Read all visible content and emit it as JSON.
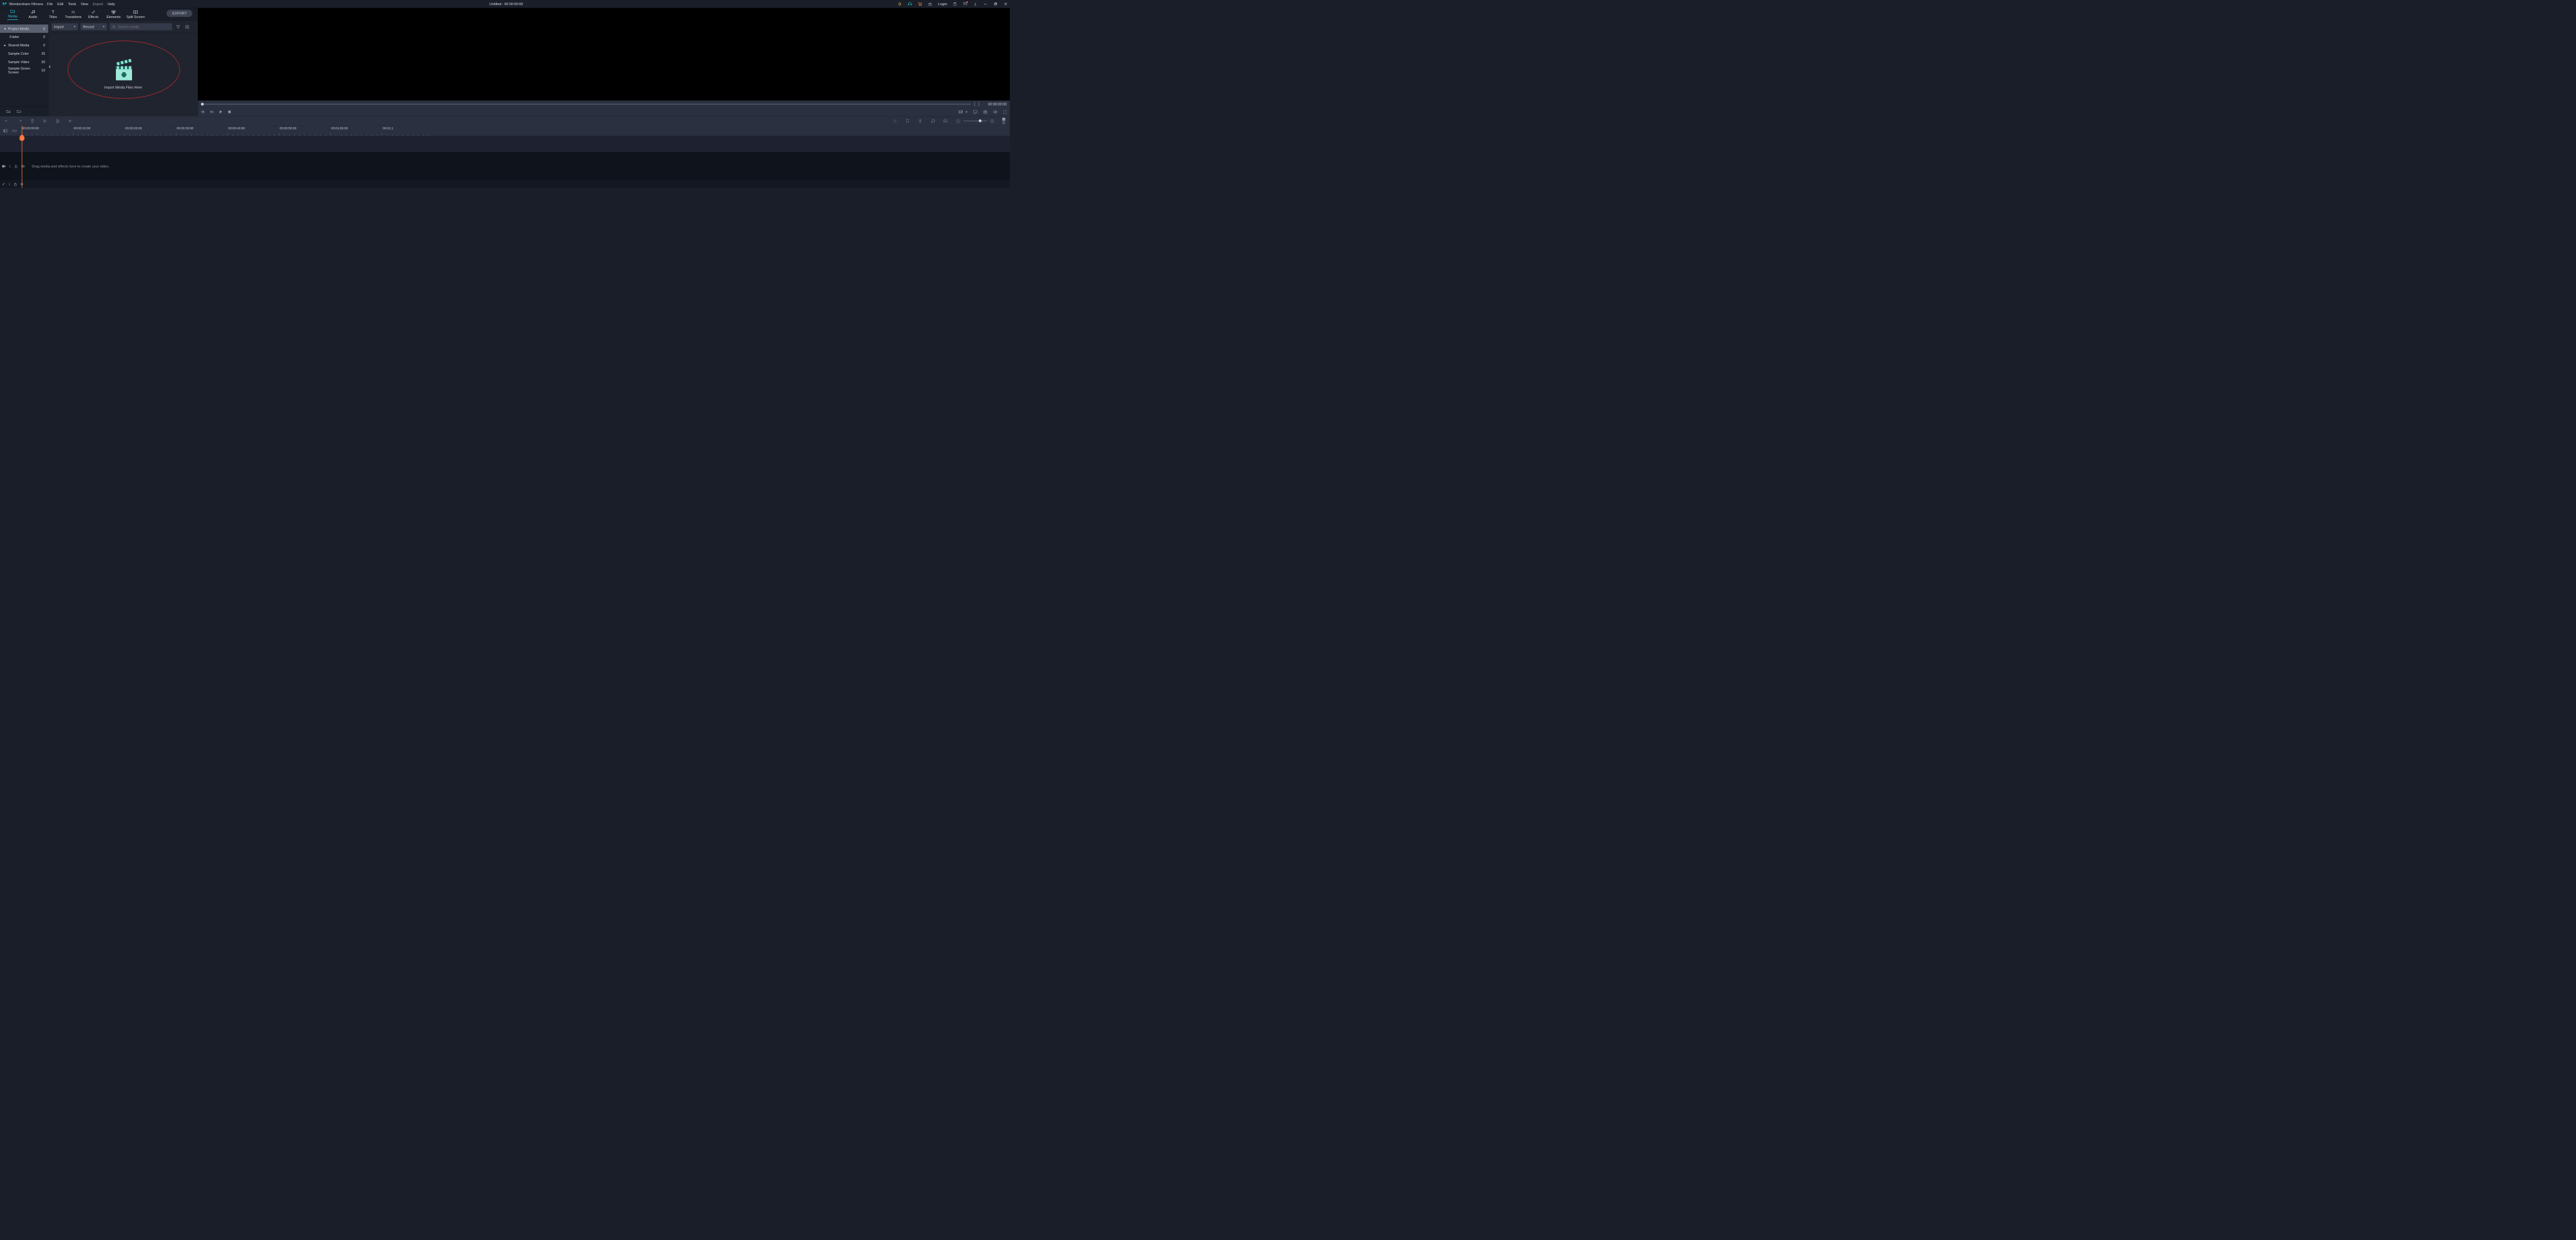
{
  "app": {
    "name": "Wondershare Filmora"
  },
  "menu": {
    "file": "File",
    "edit": "Edit",
    "tools": "Tools",
    "view": "View",
    "export": "Export",
    "help": "Help"
  },
  "doc": {
    "title": "Untitled : 00:00:00:00"
  },
  "titlebar": {
    "login": "Login"
  },
  "tabs": {
    "media": "Media",
    "audio": "Audio",
    "titles": "Titles",
    "transitions": "Transitions",
    "effects": "Effects",
    "elements": "Elements",
    "split": "Split Screen"
  },
  "export_btn": "EXPORT",
  "sidebar": {
    "items": [
      {
        "label": "Project Media",
        "count": "0",
        "arrow": "down",
        "selected": true
      },
      {
        "label": "Folder",
        "count": "0",
        "indent": true
      },
      {
        "label": "Shared Media",
        "count": "0",
        "arrow": "right"
      },
      {
        "label": "Sample Color",
        "count": "25"
      },
      {
        "label": "Sample Video",
        "count": "20"
      },
      {
        "label": "Sample Green Screen",
        "count": "10"
      }
    ]
  },
  "mediatool": {
    "import": "Import",
    "record": "Record",
    "search_placeholder": "Search media"
  },
  "dropzone": {
    "text": "Import Media Files Here"
  },
  "preview": {
    "time": "00:00:00:00",
    "ratio": "1/2"
  },
  "ruler": {
    "marks": [
      "00:00:00:00",
      "00:00:10:00",
      "00:00:20:00",
      "00:00:30:00",
      "00:00:40:00",
      "00:00:50:00",
      "00:01:00:00",
      "00:01:1"
    ]
  },
  "tracks": {
    "video_label": "1",
    "hint": "Drag media and effects here to create your video.",
    "audio_label": "1"
  }
}
